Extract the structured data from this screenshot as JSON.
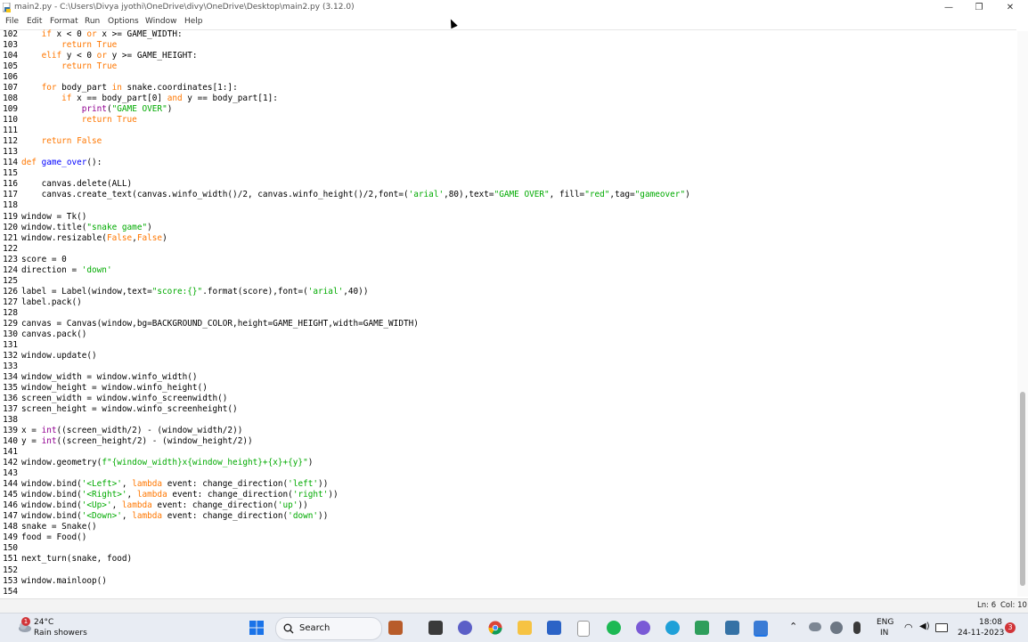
{
  "window": {
    "title": "main2.py - C:\\Users\\Divya jyothi\\OneDrive\\divy\\OneDrive\\Desktop\\main2.py (3.12.0)",
    "minimize": "—",
    "maximize": "❐",
    "close": "✕"
  },
  "menu": [
    "File",
    "Edit",
    "Format",
    "Run",
    "Options",
    "Window",
    "Help"
  ],
  "code_lines": [
    {
      "n": "102",
      "parts": [
        [
          "",
          "    "
        ],
        [
          "kw",
          "if"
        ],
        [
          "",
          " x < 0 "
        ],
        [
          "kw",
          "or"
        ],
        [
          "",
          " x >= GAME_WIDTH:"
        ]
      ]
    },
    {
      "n": "103",
      "parts": [
        [
          "",
          "        "
        ],
        [
          "kw",
          "return True"
        ]
      ]
    },
    {
      "n": "104",
      "parts": [
        [
          "",
          "    "
        ],
        [
          "kw",
          "elif"
        ],
        [
          "",
          " y < 0 "
        ],
        [
          "kw",
          "or"
        ],
        [
          "",
          " y >= GAME_HEIGHT:"
        ]
      ]
    },
    {
      "n": "105",
      "parts": [
        [
          "",
          "        "
        ],
        [
          "kw",
          "return True"
        ]
      ]
    },
    {
      "n": "106",
      "parts": [
        [
          "",
          ""
        ]
      ]
    },
    {
      "n": "107",
      "parts": [
        [
          "",
          "    "
        ],
        [
          "kw",
          "for"
        ],
        [
          "",
          " body_part "
        ],
        [
          "kw",
          "in"
        ],
        [
          "",
          " snake.coordinates[1:]:"
        ]
      ]
    },
    {
      "n": "108",
      "parts": [
        [
          "",
          "        "
        ],
        [
          "kw",
          "if"
        ],
        [
          "",
          " x == body_part[0] "
        ],
        [
          "kw",
          "and"
        ],
        [
          "",
          " y == body_part[1]:"
        ]
      ]
    },
    {
      "n": "109",
      "parts": [
        [
          "",
          "            "
        ],
        [
          "bi",
          "print"
        ],
        [
          "",
          "("
        ],
        [
          "st",
          "\"GAME OVER\""
        ],
        [
          "",
          ")"
        ]
      ]
    },
    {
      "n": "110",
      "parts": [
        [
          "",
          "            "
        ],
        [
          "kw",
          "return True"
        ]
      ]
    },
    {
      "n": "111",
      "parts": [
        [
          "",
          ""
        ]
      ]
    },
    {
      "n": "112",
      "parts": [
        [
          "",
          "    "
        ],
        [
          "kw",
          "return False"
        ]
      ]
    },
    {
      "n": "113",
      "parts": [
        [
          "",
          ""
        ]
      ]
    },
    {
      "n": "114",
      "parts": [
        [
          "kw",
          "def"
        ],
        [
          "",
          " "
        ],
        [
          "fn",
          "game_over"
        ],
        [
          "",
          "():"
        ]
      ]
    },
    {
      "n": "115",
      "parts": [
        [
          "",
          ""
        ]
      ]
    },
    {
      "n": "116",
      "parts": [
        [
          "",
          "    canvas.delete(ALL)"
        ]
      ]
    },
    {
      "n": "117",
      "parts": [
        [
          "",
          "    canvas.create_text(canvas.winfo_width()/2, canvas.winfo_height()/2,font=("
        ],
        [
          "st",
          "'arial'"
        ],
        [
          "",
          ",80),text="
        ],
        [
          "st",
          "\"GAME OVER\""
        ],
        [
          "",
          ", fill="
        ],
        [
          "st",
          "\"red\""
        ],
        [
          "",
          ",tag="
        ],
        [
          "st",
          "\"gameover\""
        ],
        [
          "",
          ")"
        ]
      ]
    },
    {
      "n": "118",
      "parts": [
        [
          "",
          ""
        ]
      ]
    },
    {
      "n": "119",
      "parts": [
        [
          "",
          "window = Tk()"
        ]
      ]
    },
    {
      "n": "120",
      "parts": [
        [
          "",
          "window.title("
        ],
        [
          "st",
          "\"snake game\""
        ],
        [
          "",
          ")"
        ]
      ]
    },
    {
      "n": "121",
      "parts": [
        [
          "",
          "window.resizable("
        ],
        [
          "kw",
          "False"
        ],
        [
          "",
          ","
        ],
        [
          "kw",
          "False"
        ],
        [
          "",
          ")"
        ]
      ]
    },
    {
      "n": "122",
      "parts": [
        [
          "",
          ""
        ]
      ]
    },
    {
      "n": "123",
      "parts": [
        [
          "",
          "score = 0"
        ]
      ]
    },
    {
      "n": "124",
      "parts": [
        [
          "",
          "direction = "
        ],
        [
          "st",
          "'down'"
        ]
      ]
    },
    {
      "n": "125",
      "parts": [
        [
          "",
          ""
        ]
      ]
    },
    {
      "n": "126",
      "parts": [
        [
          "",
          "label = Label(window,text="
        ],
        [
          "st",
          "\"score:{}\""
        ],
        [
          "",
          ".format(score),font=("
        ],
        [
          "st",
          "'arial'"
        ],
        [
          "",
          ",40))"
        ]
      ]
    },
    {
      "n": "127",
      "parts": [
        [
          "",
          "label.pack()"
        ]
      ]
    },
    {
      "n": "128",
      "parts": [
        [
          "",
          ""
        ]
      ]
    },
    {
      "n": "129",
      "parts": [
        [
          "",
          "canvas = Canvas(window,bg=BACKGROUND_COLOR,height=GAME_HEIGHT,width=GAME_WIDTH)"
        ]
      ]
    },
    {
      "n": "130",
      "parts": [
        [
          "",
          "canvas.pack()"
        ]
      ]
    },
    {
      "n": "131",
      "parts": [
        [
          "",
          ""
        ]
      ]
    },
    {
      "n": "132",
      "parts": [
        [
          "",
          "window.update()"
        ]
      ]
    },
    {
      "n": "133",
      "parts": [
        [
          "",
          ""
        ]
      ]
    },
    {
      "n": "134",
      "parts": [
        [
          "",
          "window_width = window.winfo_width()"
        ]
      ]
    },
    {
      "n": "135",
      "parts": [
        [
          "",
          "window_height = window.winfo_height()"
        ]
      ]
    },
    {
      "n": "136",
      "parts": [
        [
          "",
          "screen_width = window.winfo_screenwidth()"
        ]
      ]
    },
    {
      "n": "137",
      "parts": [
        [
          "",
          "screen_height = window.winfo_screenheight()"
        ]
      ]
    },
    {
      "n": "138",
      "parts": [
        [
          "",
          ""
        ]
      ]
    },
    {
      "n": "139",
      "parts": [
        [
          "",
          "x = "
        ],
        [
          "bi",
          "int"
        ],
        [
          "",
          "((screen_width/2) - (window_width/2))"
        ]
      ]
    },
    {
      "n": "140",
      "parts": [
        [
          "",
          "y = "
        ],
        [
          "bi",
          "int"
        ],
        [
          "",
          "((screen_height/2) - (window_height/2))"
        ]
      ]
    },
    {
      "n": "141",
      "parts": [
        [
          "",
          ""
        ]
      ]
    },
    {
      "n": "142",
      "parts": [
        [
          "",
          "window.geometry("
        ],
        [
          "st",
          "f\"{window_width}x{window_height}+{x}+{y}\""
        ],
        [
          "",
          ")"
        ]
      ]
    },
    {
      "n": "143",
      "parts": [
        [
          "",
          ""
        ]
      ]
    },
    {
      "n": "144",
      "parts": [
        [
          "",
          "window.bind("
        ],
        [
          "st",
          "'<Left>'"
        ],
        [
          "",
          ", "
        ],
        [
          "kw",
          "lambda"
        ],
        [
          "",
          " event: change_direction("
        ],
        [
          "st",
          "'left'"
        ],
        [
          "",
          "))"
        ]
      ]
    },
    {
      "n": "145",
      "parts": [
        [
          "",
          "window.bind("
        ],
        [
          "st",
          "'<Right>'"
        ],
        [
          "",
          ", "
        ],
        [
          "kw",
          "lambda"
        ],
        [
          "",
          " event: change_direction("
        ],
        [
          "st",
          "'right'"
        ],
        [
          "",
          "))"
        ]
      ]
    },
    {
      "n": "146",
      "parts": [
        [
          "",
          "window.bind("
        ],
        [
          "st",
          "'<Up>'"
        ],
        [
          "",
          ", "
        ],
        [
          "kw",
          "lambda"
        ],
        [
          "",
          " event: change_direction("
        ],
        [
          "st",
          "'up'"
        ],
        [
          "",
          "))"
        ]
      ]
    },
    {
      "n": "147",
      "parts": [
        [
          "",
          "window.bind("
        ],
        [
          "st",
          "'<Down>'"
        ],
        [
          "",
          ", "
        ],
        [
          "kw",
          "lambda"
        ],
        [
          "",
          " event: change_direction("
        ],
        [
          "st",
          "'down'"
        ],
        [
          "",
          "))"
        ]
      ]
    },
    {
      "n": "148",
      "parts": [
        [
          "",
          "snake = Snake()"
        ]
      ]
    },
    {
      "n": "149",
      "parts": [
        [
          "",
          "food = Food()"
        ]
      ]
    },
    {
      "n": "150",
      "parts": [
        [
          "",
          ""
        ]
      ]
    },
    {
      "n": "151",
      "parts": [
        [
          "",
          "next_turn(snake, food)"
        ]
      ]
    },
    {
      "n": "152",
      "parts": [
        [
          "",
          ""
        ]
      ]
    },
    {
      "n": "153",
      "parts": [
        [
          "",
          "window.mainloop()"
        ]
      ]
    },
    {
      "n": "154",
      "parts": [
        [
          "",
          ""
        ]
      ]
    }
  ],
  "status": {
    "line": "Ln: 6",
    "col": "Col: 10"
  },
  "taskbar": {
    "weather_temp": "24°C",
    "weather_desc": "Rain showers",
    "weather_badge": "1",
    "search_label": "Search",
    "lang_top": "ENG",
    "lang_bottom": "IN",
    "time": "18:08",
    "date": "24-11-2023",
    "notif_count": "3"
  },
  "colors": {
    "keyword": "#ff7700",
    "string": "#00aa00",
    "builtin": "#900090",
    "defname": "#0000ff"
  }
}
